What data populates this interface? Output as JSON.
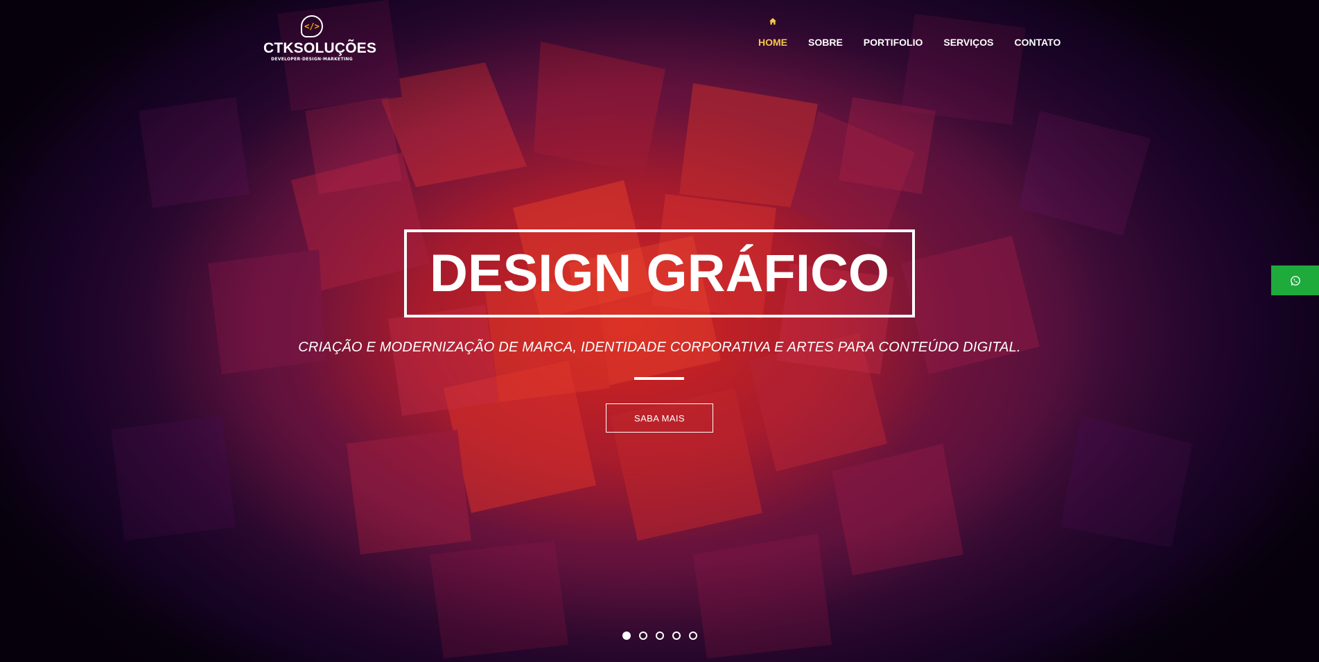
{
  "brand": {
    "logo_symbol": "</>",
    "name": "CTKSOLUÇÕES",
    "tagline": "DEVELOPER·DESIGN·MARKETING",
    "accent_color": "#f4c84a"
  },
  "nav": {
    "home_icon": "home-icon",
    "items": [
      {
        "label": "HOME",
        "active": true
      },
      {
        "label": "SOBRE",
        "active": false
      },
      {
        "label": "PORTIFOLIO",
        "active": false
      },
      {
        "label": "SERVIÇOS",
        "active": false
      },
      {
        "label": "CONTATO",
        "active": false
      }
    ]
  },
  "hero": {
    "title": "DESIGN GRÁFICO",
    "subtitle": "CRIAÇÃO E MODERNIZAÇÃO DE MARCA, IDENTIDADE CORPORATIVA E ARTES PARA CONTEÚDO DIGITAL.",
    "cta_label": "SABA MAIS"
  },
  "slider": {
    "total_slides": 5,
    "active_index": 0
  },
  "whatsapp": {
    "icon": "whatsapp-icon",
    "color": "#1faa3c"
  }
}
